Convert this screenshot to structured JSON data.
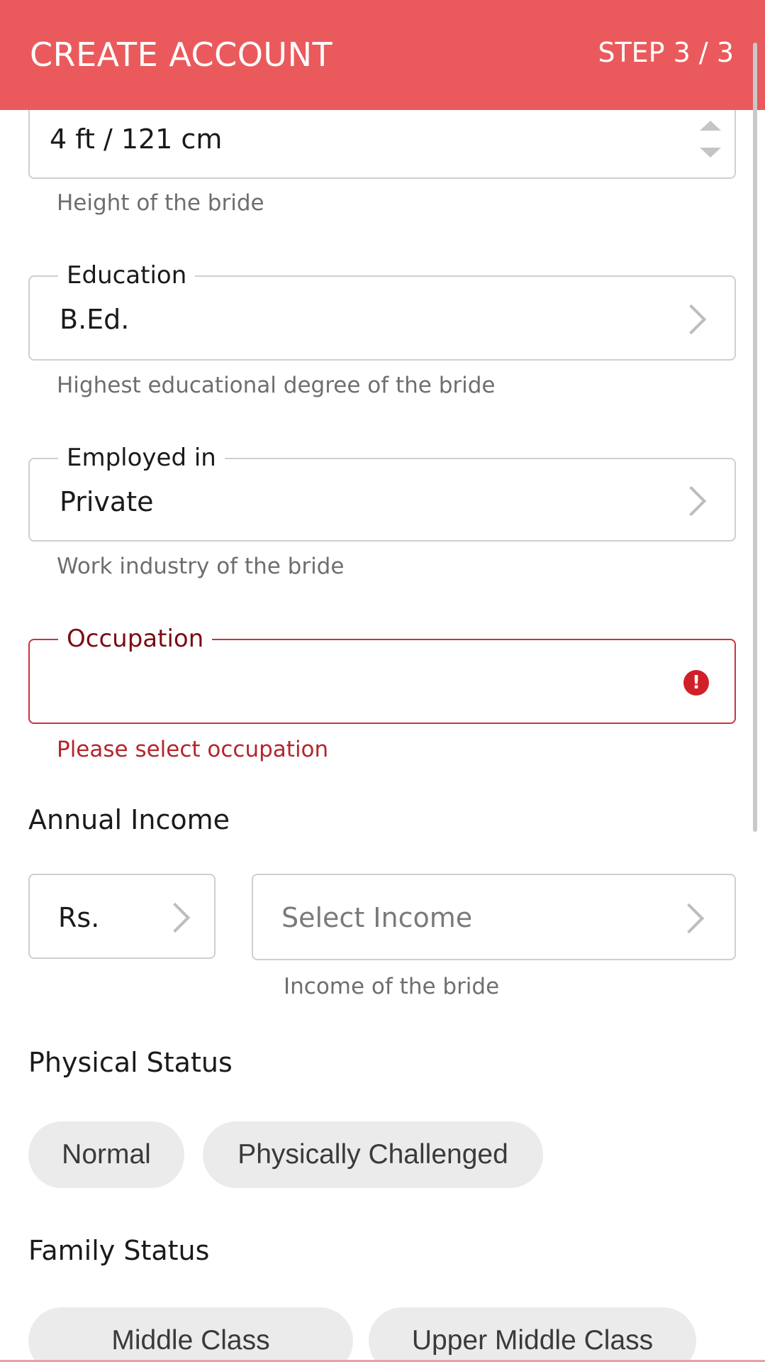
{
  "header": {
    "title": "CREATE ACCOUNT",
    "step": "STEP 3 / 3"
  },
  "height_field": {
    "value": "4 ft / 121 cm",
    "helper": "Height of the bride"
  },
  "education_field": {
    "label": "Education",
    "value": "B.Ed.",
    "helper": "Highest educational degree of the bride"
  },
  "employed_field": {
    "label": "Employed in",
    "value": "Private",
    "helper": "Work industry of the bride"
  },
  "occupation_field": {
    "label": "Occupation",
    "value": "",
    "error": "Please select occupation"
  },
  "annual_income": {
    "title": "Annual Income",
    "currency": "Rs.",
    "placeholder": "Select Income",
    "helper": "Income of the bride"
  },
  "physical_status": {
    "title": "Physical Status",
    "options": [
      "Normal",
      "Physically Challenged"
    ]
  },
  "family_status": {
    "title": "Family Status",
    "options": [
      "Middle Class",
      "Upper Middle Class"
    ]
  },
  "colors": {
    "brand": "#ea5a5c",
    "error": "#c9363e",
    "chip_bg": "#ebebeb"
  }
}
